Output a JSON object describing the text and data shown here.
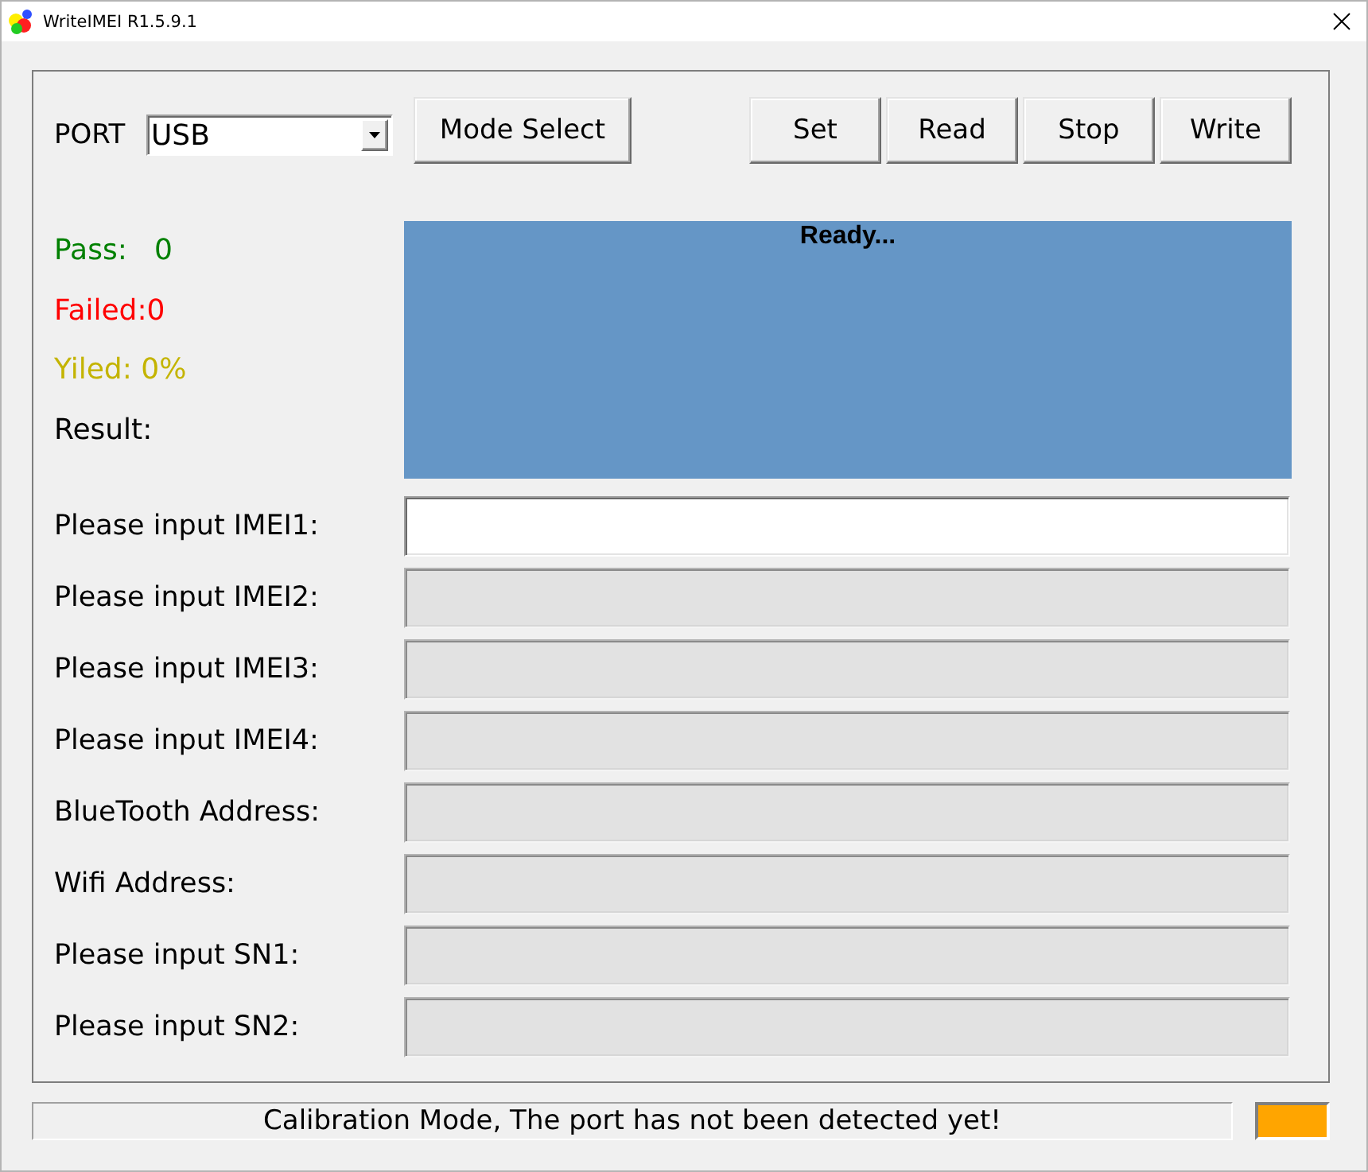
{
  "window": {
    "title": "WriteIMEI R1.5.9.1"
  },
  "toolbar": {
    "port_label": "PORT",
    "port_select": {
      "value": "USB"
    },
    "mode_button": "Mode Select",
    "action_buttons": [
      "Set",
      "Read",
      "Stop",
      "Write"
    ]
  },
  "counters": [
    {
      "text": "Pass:   0",
      "color": "#008000"
    },
    {
      "text": "Failed:0",
      "color": "#ff0000"
    },
    {
      "text": "Yiled: 0%",
      "color": "#c4b400"
    },
    {
      "text": "Result:",
      "color": "#000000"
    }
  ],
  "result_panel": {
    "message": "Ready..."
  },
  "fields": [
    {
      "label": "Please input IMEI1:",
      "disabled": false
    },
    {
      "label": "Please input IMEI2:",
      "disabled": true
    },
    {
      "label": "Please input IMEI3:",
      "disabled": true
    },
    {
      "label": "Please input IMEI4:",
      "disabled": true
    },
    {
      "label": "BlueTooth Address:",
      "disabled": true
    },
    {
      "label": "Wifi Address:",
      "disabled": true
    },
    {
      "label": "Please input SN1:",
      "disabled": true
    },
    {
      "label": "Please input SN2:",
      "disabled": true
    }
  ],
  "status_bar": {
    "message": "Calibration Mode, The port has not been detected yet!",
    "indicator": {
      "color": "#ffa500"
    }
  }
}
